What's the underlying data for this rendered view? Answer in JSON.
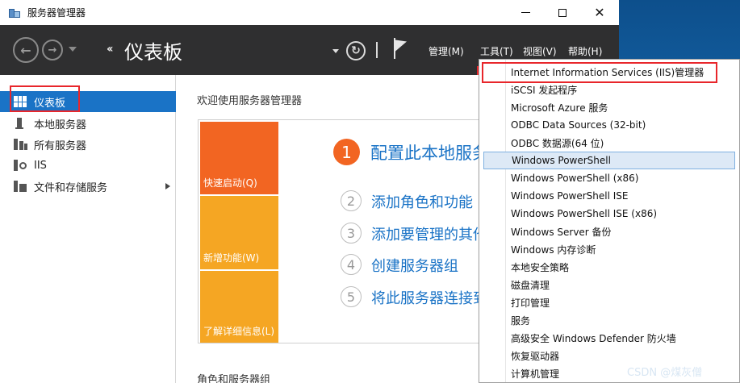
{
  "window": {
    "title": "服务器管理器",
    "controls": {
      "minimize": "",
      "maximize": "",
      "close": "✕"
    }
  },
  "header": {
    "breadcrumb_arrows": "‹‹",
    "page_title": "仪表板",
    "menu": {
      "manage": "管理(M)",
      "tools": "工具(T)",
      "view": "视图(V)",
      "help": "帮助(H)"
    },
    "icons": {
      "back": "back-arrow-icon",
      "forward": "forward-arrow-icon",
      "refresh": "refresh-icon",
      "flag": "notifications-flag-icon"
    }
  },
  "sidebar": {
    "items": [
      {
        "label": "仪表板",
        "icon": "dashboard-icon",
        "active": true
      },
      {
        "label": "本地服务器",
        "icon": "local-server-icon"
      },
      {
        "label": "所有服务器",
        "icon": "all-servers-icon"
      },
      {
        "label": "IIS",
        "icon": "iis-icon"
      },
      {
        "label": "文件和存储服务",
        "icon": "file-storage-icon",
        "expandable": true
      }
    ]
  },
  "main": {
    "welcome": "欢迎使用服务器管理器",
    "tiles": {
      "quick_start": "快速启动(Q)",
      "whats_new": "新增功能(W)",
      "learn_more": "了解详细信息(L)"
    },
    "steps": [
      {
        "num": "1",
        "text": "配置此本地服务器"
      },
      {
        "num": "2",
        "text": "添加角色和功能"
      },
      {
        "num": "3",
        "text": "添加要管理的其他服务器"
      },
      {
        "num": "4",
        "text": "创建服务器组"
      },
      {
        "num": "5",
        "text": "将此服务器连接到云服务"
      }
    ],
    "roles_heading": "角色和服务器组"
  },
  "tools_menu": {
    "items": [
      "Internet Information Services (IIS)管理器",
      "iSCSI 发起程序",
      "Microsoft Azure 服务",
      "ODBC Data Sources (32-bit)",
      "ODBC 数据源(64 位)",
      "Windows PowerShell",
      "Windows PowerShell (x86)",
      "Windows PowerShell ISE",
      "Windows PowerShell ISE (x86)",
      "Windows Server 备份",
      "Windows 内存诊断",
      "本地安全策略",
      "磁盘清理",
      "打印管理",
      "服务",
      "高级安全 Windows Defender 防火墙",
      "恢复驱动器",
      "计算机管理"
    ],
    "highlighted_index": 5
  },
  "watermark": "CSDN @煤灰僧",
  "colors": {
    "accent": "#1a73c6",
    "header_bg": "#2f2f30",
    "tile_orange": "#f26522",
    "tile_amber": "#f5a623",
    "highlight_red": "#e8262b"
  }
}
